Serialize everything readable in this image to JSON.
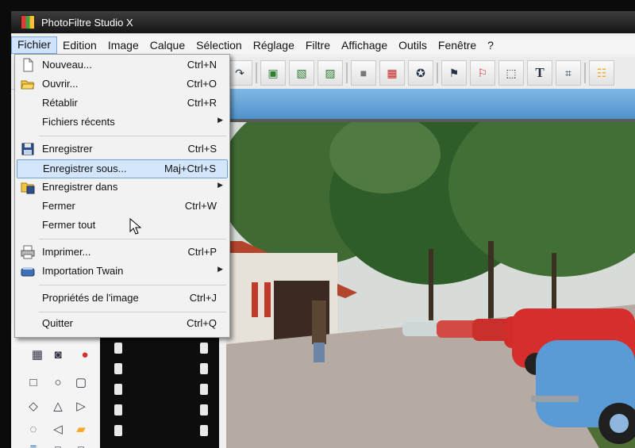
{
  "app": {
    "title": "PhotoFiltre Studio X"
  },
  "menubar": {
    "items": [
      "Fichier",
      "Edition",
      "Image",
      "Calque",
      "Sélection",
      "Réglage",
      "Filtre",
      "Affichage",
      "Outils",
      "Fenêtre",
      "?"
    ]
  },
  "file_menu": {
    "items": [
      {
        "label": "Nouveau...",
        "shortcut": "Ctrl+N",
        "icon": "new-file-icon"
      },
      {
        "label": "Ouvrir...",
        "shortcut": "Ctrl+O",
        "icon": "open-folder-icon"
      },
      {
        "label": "Rétablir",
        "shortcut": "Ctrl+R"
      },
      {
        "label": "Fichiers récents",
        "submenu": true
      },
      {
        "label": "Enregistrer",
        "shortcut": "Ctrl+S",
        "icon": "save-icon"
      },
      {
        "label": "Enregistrer sous...",
        "shortcut": "Maj+Ctrl+S",
        "highlighted": true
      },
      {
        "label": "Enregistrer dans",
        "submenu": true,
        "icon": "save-to-icon"
      },
      {
        "label": "Fermer",
        "shortcut": "Ctrl+W"
      },
      {
        "label": "Fermer tout"
      },
      {
        "label": "Imprimer...",
        "shortcut": "Ctrl+P",
        "icon": "printer-icon"
      },
      {
        "label": "Importation Twain",
        "submenu": true,
        "icon": "scanner-icon"
      },
      {
        "label": "Propriétés de l'image",
        "shortcut": "Ctrl+J"
      },
      {
        "label": "Quitter",
        "shortcut": "Ctrl+Q"
      }
    ]
  },
  "colors": {
    "highlight": "#d4e6fb",
    "highlight_border": "#6e9fd8",
    "doc_bar": "#5b9bd5"
  }
}
